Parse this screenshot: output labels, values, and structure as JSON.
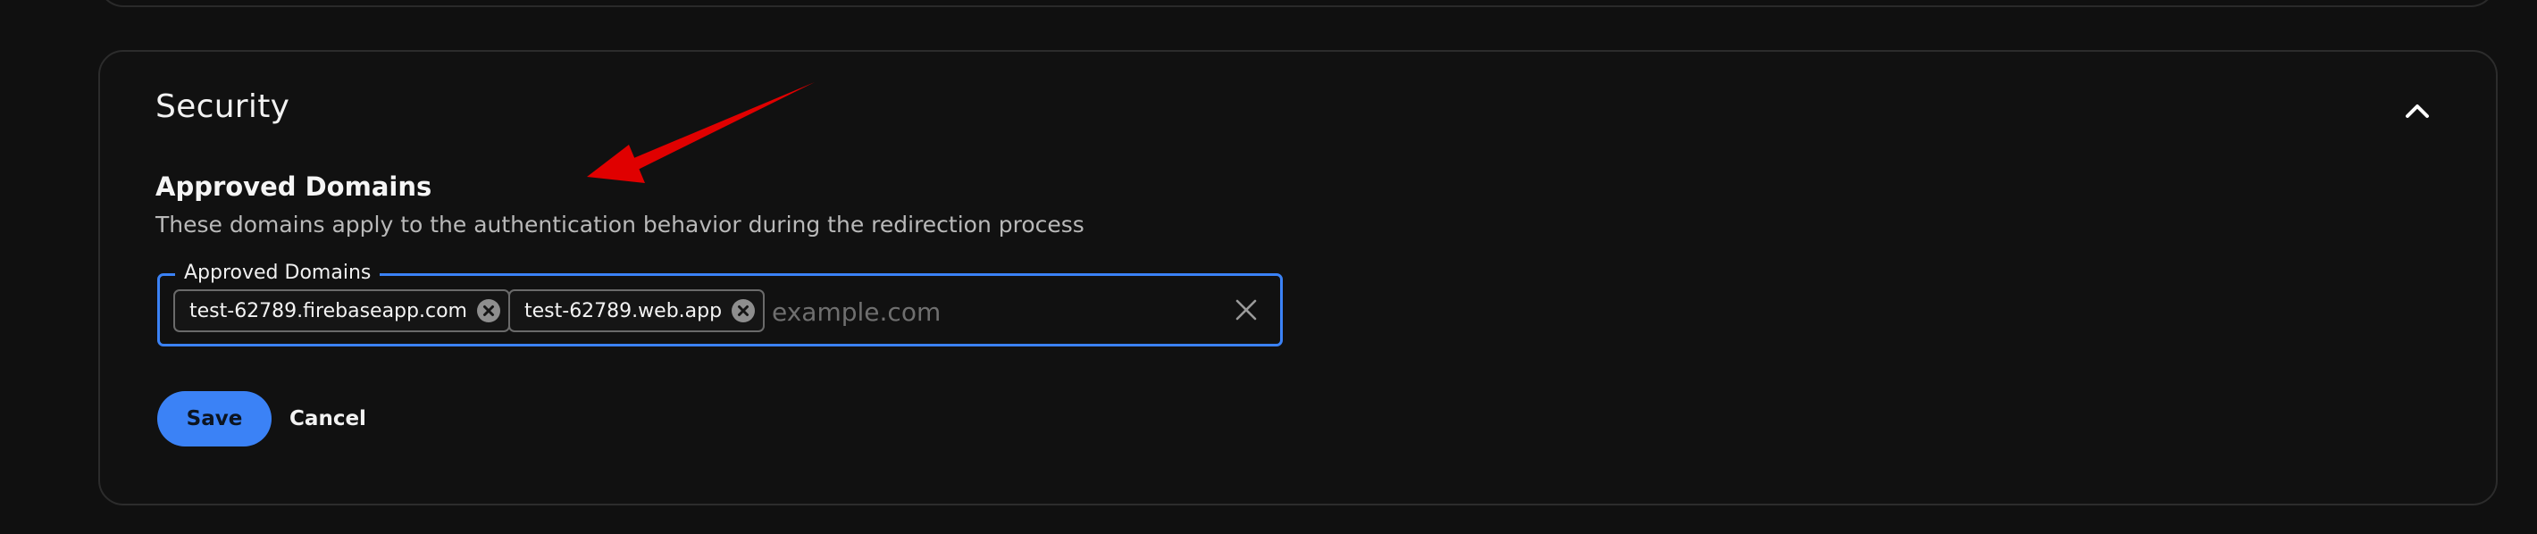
{
  "security": {
    "title": "Security",
    "collapse_icon": "chevron-up-icon",
    "approved_domains": {
      "heading": "Approved Domains",
      "description": "These domains apply to the authentication behavior during the redirection process",
      "field_label": "Approved Domains",
      "chips": [
        {
          "label": "test-62789.firebaseapp.com",
          "remove_icon": "close-circle-icon"
        },
        {
          "label": "test-62789.web.app",
          "remove_icon": "close-circle-icon"
        }
      ],
      "input_value": "",
      "input_placeholder": "example.com",
      "clear_icon": "close-icon"
    },
    "actions": {
      "save_label": "Save",
      "cancel_label": "Cancel"
    }
  },
  "annotation": {
    "arrow_icon": "red-arrow-annotation"
  },
  "colors": {
    "background": "#101010",
    "accent": "#3b82f6",
    "annotation": "#e00000"
  }
}
